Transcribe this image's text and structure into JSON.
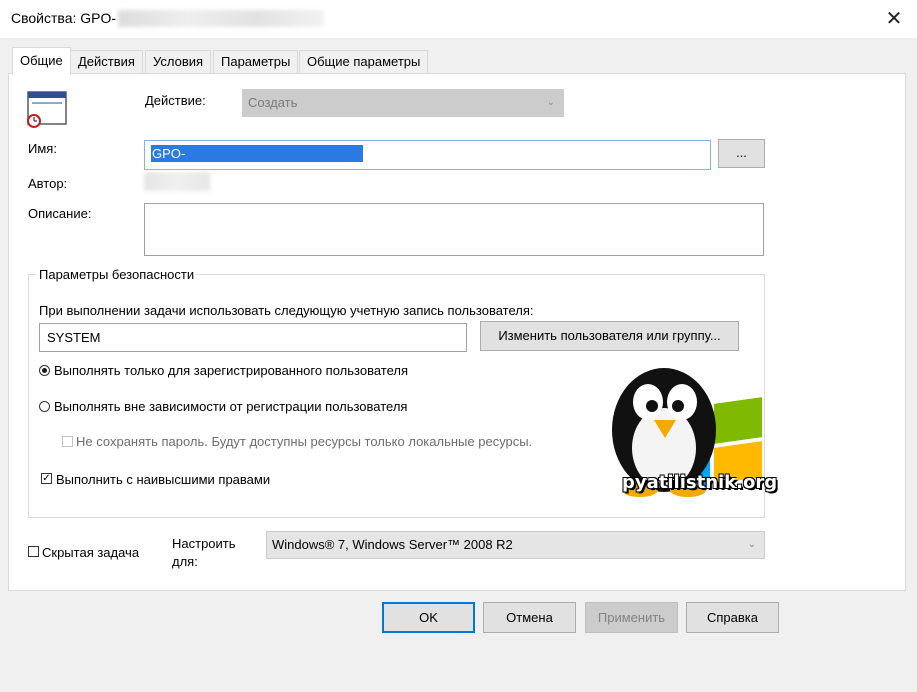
{
  "window": {
    "title": "Свойства: GPO-",
    "close_glyph": "✕"
  },
  "tabs": [
    {
      "label": "Общие",
      "active": true
    },
    {
      "label": "Действия",
      "active": false
    },
    {
      "label": "Условия",
      "active": false
    },
    {
      "label": "Параметры",
      "active": false
    },
    {
      "label": "Общие параметры",
      "active": false
    }
  ],
  "general": {
    "task_icon": "scheduled-task-icon",
    "action_label": "Действие:",
    "action_value": "Создать",
    "name_label": "Имя:",
    "name_value": "GPO-",
    "browse_label": "...",
    "author_label": "Автор:",
    "description_label": "Описание:",
    "description_value": ""
  },
  "security": {
    "group_title": "Параметры безопасности",
    "account_prompt": "При выполнении задачи использовать следующую учетную запись пользователя:",
    "account_value": "SYSTEM",
    "change_user_label": "Изменить пользователя или группу...",
    "radio_logged_on": {
      "label": "Выполнять только для зарегистрированного пользователя",
      "checked": true
    },
    "radio_any": {
      "label": "Выполнять вне зависимости от регистрации пользователя",
      "checked": false
    },
    "no_store_password": {
      "label": "Не сохранять пароль. Будут доступны ресурсы только локальные ресурсы.",
      "checked": false,
      "disabled": true
    },
    "highest_privileges": {
      "label": "Выполнить с наивысшими правами",
      "checked": true
    }
  },
  "footer": {
    "hidden_task": {
      "label": "Скрытая задача",
      "checked": false
    },
    "configure_label_1": "Настроить",
    "configure_label_2": "для:",
    "configure_value": "Windows® 7, Windows Server™ 2008 R2"
  },
  "buttons": {
    "ok": "OK",
    "cancel": "Отмена",
    "apply": "Применить",
    "help": "Справка"
  },
  "watermark": {
    "text": "pyatilistnik.org"
  },
  "colors": {
    "selection": "#2a7ae2",
    "focus_border": "#0078d7"
  }
}
